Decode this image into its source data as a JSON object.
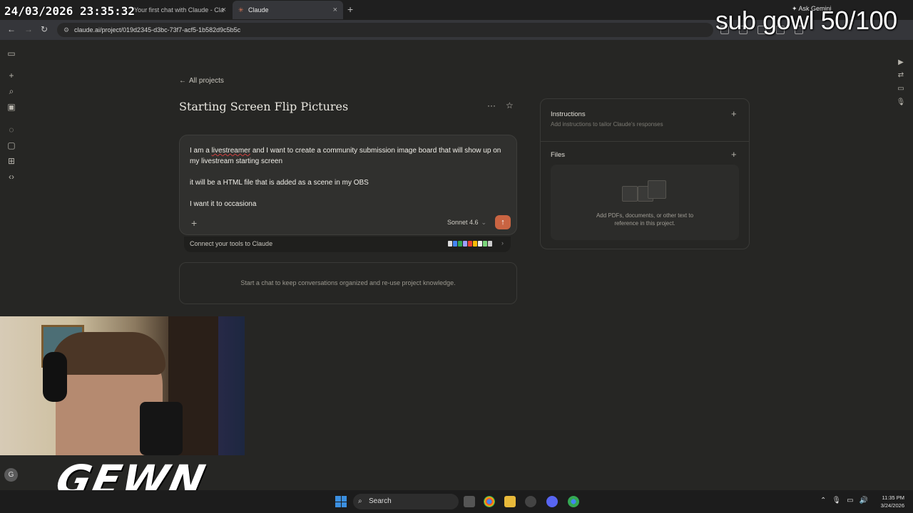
{
  "overlay": {
    "timestamp": "24/03/2026 23:35:32",
    "sub_goal": "sub gowl 50/100",
    "logo_text": "GEWN"
  },
  "browser": {
    "tabs": [
      {
        "label": "Your first chat with Claude - Cla",
        "active": false
      },
      {
        "label": "Claude",
        "active": true
      }
    ],
    "close_glyph": "×",
    "new_tab_glyph": "+",
    "ask_gemini": "Ask Gemini",
    "url": "claude.ai/project/019d2345-d3bc-73f7-acf5-1b582d9c5b5c"
  },
  "page": {
    "back_link": "All projects",
    "title": "Starting Screen Flip Pictures",
    "composer": {
      "line1_pre": "I am a ",
      "line1_misspelled": "livestreamer",
      "line1_post": " and I want to create a community submission image board that will show up on my livestream starting screen",
      "line2": "it will be a HTML file that is added as a scene in my OBS",
      "line3": "I want it to occasiona",
      "model": "Sonnet 4.6"
    },
    "connect_tools": "Connect your tools to Claude",
    "empty_chats": "Start a chat to keep conversations organized and re-use project knowledge."
  },
  "side_panel": {
    "instructions_title": "Instructions",
    "instructions_hint": "Add instructions to tailor Claude's responses",
    "files_title": "Files",
    "files_hint_line1": "Add PDFs, documents, or other text to",
    "files_hint_line2": "reference in this project."
  },
  "taskbar": {
    "search_label": "Search",
    "time": "11:35 PM",
    "date": "3/24/2026",
    "user_initial": "G"
  },
  "colors": {
    "accent": "#c96442",
    "background": "#262624",
    "panel": "#30302e"
  }
}
